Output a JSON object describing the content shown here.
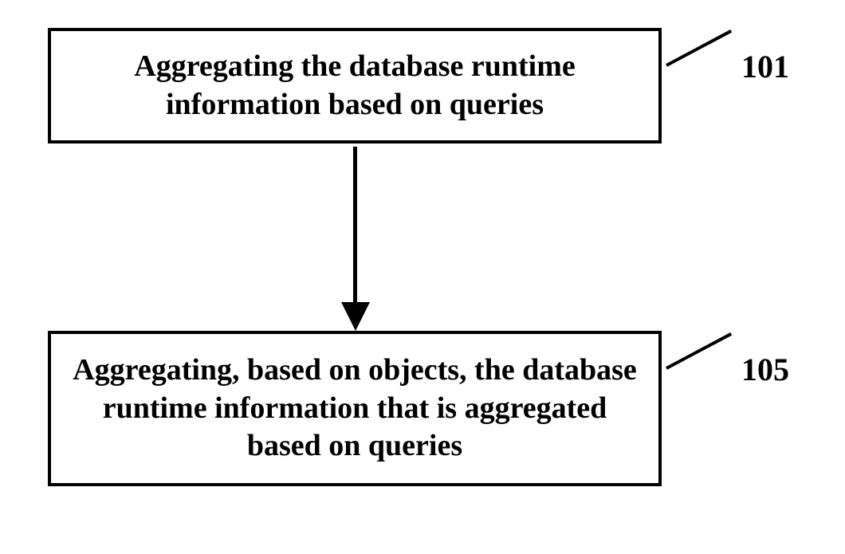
{
  "chart_data": {
    "type": "flowchart",
    "nodes": [
      {
        "id": "101",
        "label": "101",
        "text": "Aggregating the database runtime information based on queries"
      },
      {
        "id": "105",
        "label": "105",
        "text": "Aggregating, based on objects, the database runtime information that is aggregated based on queries"
      }
    ],
    "edges": [
      {
        "from": "101",
        "to": "105"
      }
    ]
  }
}
